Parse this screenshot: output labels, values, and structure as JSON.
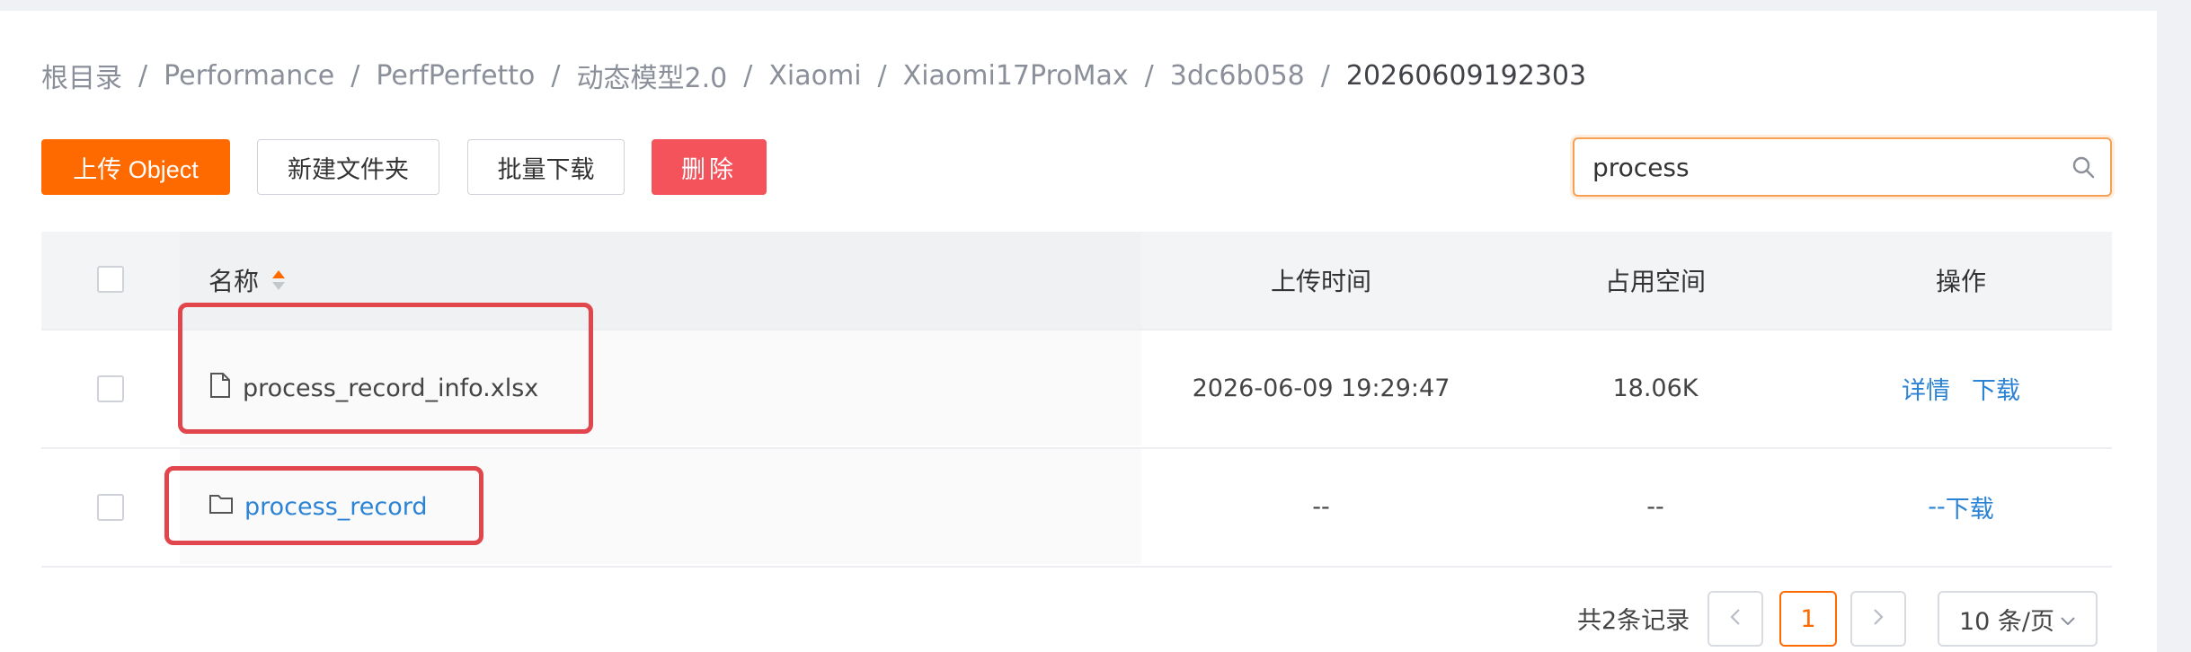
{
  "breadcrumb": [
    {
      "label": "根目录"
    },
    {
      "label": "Performance"
    },
    {
      "label": "PerfPerfetto"
    },
    {
      "label": "动态模型2.0"
    },
    {
      "label": "Xiaomi"
    },
    {
      "label": "Xiaomi17ProMax"
    },
    {
      "label": "3dc6b058"
    },
    {
      "label": "20260609192303"
    }
  ],
  "breadcrumb_separator": "/",
  "toolbar": {
    "upload_label": "上传 Object",
    "new_folder_label": "新建文件夹",
    "batch_download_label": "批量下载",
    "delete_label": "删除"
  },
  "search": {
    "value": "process",
    "icon": "search-icon"
  },
  "table": {
    "headers": {
      "name": "名称",
      "upload_time": "上传时间",
      "size": "占用空间",
      "actions": "操作"
    },
    "rows": [
      {
        "type": "file",
        "icon": "file-icon",
        "name": "process_record_info.xlsx",
        "upload_time": "2026-06-09 19:29:47",
        "size": "18.06K",
        "action_detail": "详情",
        "action_download": "下载"
      },
      {
        "type": "folder",
        "icon": "folder-icon",
        "name": "process_record",
        "upload_time": "--",
        "size": "--",
        "action_detail": "--",
        "action_download": "下载"
      }
    ]
  },
  "pagination": {
    "total_text": "共2条记录",
    "current_page": "1",
    "page_size_label": "10 条/页"
  },
  "colors": {
    "primary": "#ff6a00",
    "danger": "#f5535b",
    "link": "#2a83d4",
    "highlight": "#e2464d"
  }
}
